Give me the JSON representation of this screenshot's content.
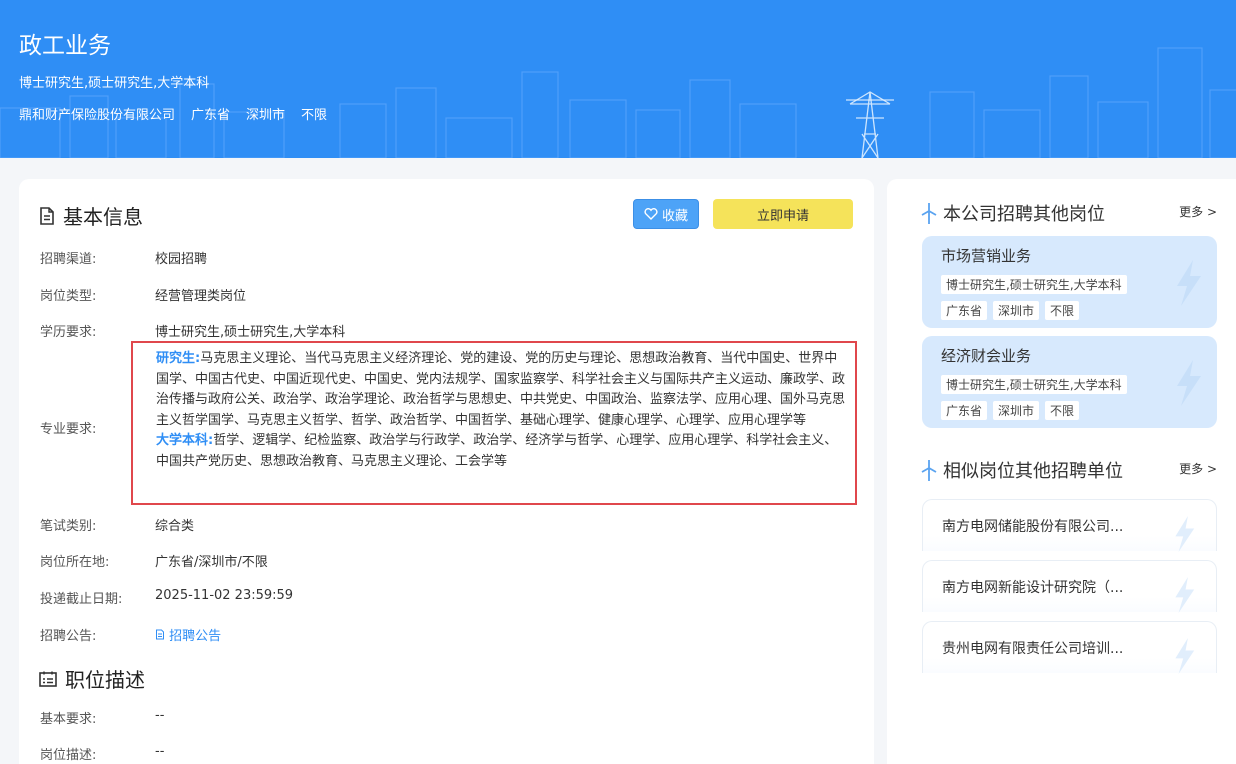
{
  "header": {
    "title": "政工业务",
    "education": "博士研究生,硕士研究生,大学本科",
    "company": "鼎和财产保险股份有限公司",
    "province": "广东省",
    "city": "深圳市",
    "district": "不限"
  },
  "basic_info": {
    "heading": "基本信息",
    "favorite_label": "收藏",
    "apply_label": "立即申请",
    "fields": {
      "channel_label": "招聘渠道:",
      "channel_value": "校园招聘",
      "type_label": "岗位类型:",
      "type_value": "经营管理类岗位",
      "edu_label": "学历要求:",
      "edu_value": "博士研究生,硕士研究生,大学本科",
      "major_label": "专业要求:",
      "major_grad_title": "研究生:",
      "major_grad_text": "马克思主义理论、当代马克思主义经济理论、党的建设、党的历史与理论、思想政治教育、当代中国史、世界中国学、中国古代史、中国近现代史、中国史、党内法规学、国家监察学、科学社会主义与国际共产主义运动、廉政学、政治传播与政府公关、政治学、政治学理论、政治哲学与思想史、中共党史、中国政治、监察法学、应用心理、国外马克思主义哲学国学、马克思主义哲学、哲学、政治哲学、中国哲学、基础心理学、健康心理学、心理学、应用心理学等",
      "major_ug_title": "大学本科:",
      "major_ug_text": "哲学、逻辑学、纪检监察、政治学与行政学、政治学、经济学与哲学、心理学、应用心理学、科学社会主义、中国共产党历史、思想政治教育、马克思主义理论、工会学等",
      "exam_label": "笔试类别:",
      "exam_value": "综合类",
      "location_label": "岗位所在地:",
      "location_value": "广东省/深圳市/不限",
      "deadline_label": "投递截止日期:",
      "deadline_value": "2025-11-02 23:59:59",
      "notice_label": "招聘公告:",
      "notice_value": "招聘公告"
    }
  },
  "job_desc": {
    "heading": "职位描述",
    "basic_req_label": "基本要求:",
    "basic_req_value": "--",
    "desc_label": "岗位描述:",
    "desc_value": "--"
  },
  "sidebar": {
    "other_jobs_heading": "本公司招聘其他岗位",
    "more_label": "更多 >",
    "other_jobs": [
      {
        "title": "市场营销业务",
        "edu": "博士研究生,硕士研究生,大学本科",
        "province": "广东省",
        "city": "深圳市",
        "district": "不限"
      },
      {
        "title": "经济财会业务",
        "edu": "博士研究生,硕士研究生,大学本科",
        "province": "广东省",
        "city": "深圳市",
        "district": "不限"
      }
    ],
    "similar_heading": "相似岗位其他招聘单位",
    "similar_more_label": "更多 >",
    "similar_units": [
      "南方电网储能股份有限公司...",
      "南方电网新能设计研究院（...",
      "贵州电网有限责任公司培训..."
    ]
  },
  "colors": {
    "banner_blue": "#2f8ef5",
    "apply_yellow": "#f5e35a",
    "highlight_red": "#e0474c",
    "card_blue": "#d7e9fd"
  }
}
